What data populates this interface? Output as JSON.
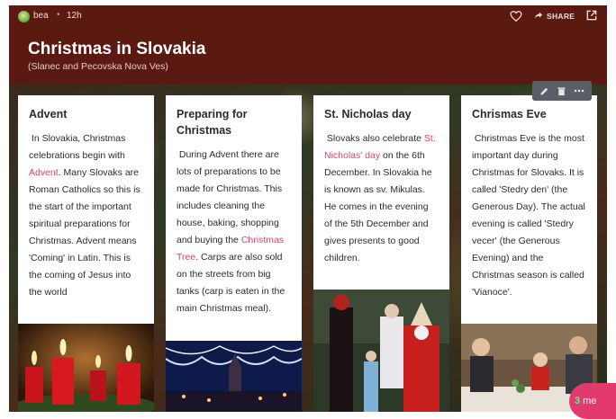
{
  "post": {
    "author": "bea",
    "separator": "•",
    "time": "12h",
    "share_label": "SHARE",
    "title": "Christmas in Slovakia",
    "subtitle": "(Slanec and Pecovska Nova Ves)"
  },
  "icons": {
    "like": "heart-icon",
    "share": "share-arrow-icon",
    "open": "open-external-icon",
    "edit": "pencil-icon",
    "delete": "trash-icon",
    "more": "more-horizontal-icon"
  },
  "colors": {
    "header_bg": "#5a1a12",
    "link": "#e0406a",
    "fab": "#e33a6e",
    "toolbar": "#5a5f66"
  },
  "cards": [
    {
      "title": "Advent",
      "t1": "In Slovakia, Christmas celebrations begin with ",
      "link": "Advent",
      "t2": ". Many Slovaks are Roman Catholics so this is the start of the important spiritual preparations for Christmas.  Advent means 'Coming' in Latin. This is the coming of Jesus into the world"
    },
    {
      "title": "Preparing for Christmas",
      "t1": "During Advent there are lots of preparations to be made for Christmas. This includes cleaning the house, baking, shopping and buying the ",
      "link": "Christmas Tree",
      "t2": ". Carps are also sold on the streets from big tanks (carp is eaten in the main Christmas meal)."
    },
    {
      "title": "St. Nicholas day",
      "t1": "Slovaks also celebrate ",
      "link": "St. Nicholas' day",
      "t2": " on the 6th December. In Slovakia he is known as sv. Mikulas. He comes in the evening of the 5th December and gives presents to good children."
    },
    {
      "title": "Chrismas Eve",
      "t1": "Christmas Eve is the most important day during Christmas for Slovaks. It is called 'Stedry den' (the Generous Day). The actual evening is called 'Stedry vecer' (the Generous Evening) and the Christmas season is called 'Vianoce'."
    }
  ],
  "fab": {
    "badge": "3",
    "label": "me"
  }
}
